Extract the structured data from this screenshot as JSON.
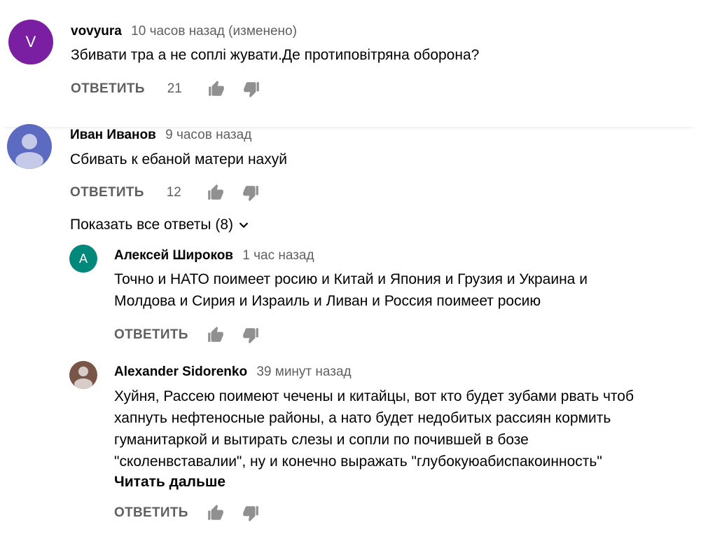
{
  "comments": [
    {
      "author": "vovyura",
      "time": "10 часов назад (изменено)",
      "avatar_letter": "V",
      "avatar_color": "#7b1fa2",
      "text": "Збивати тра а не соплі жувати.Де протиповітряна оборона?",
      "reply_label": "ОТВЕТИТЬ",
      "likes": "21"
    },
    {
      "author": "Иван Иванов",
      "time": "9 часов назад",
      "avatar_color": "#5c6bc0",
      "text": "Сбивать к ебаной матери нахуй",
      "reply_label": "ОТВЕТИТЬ",
      "likes": "12",
      "show_replies": "Показать все ответы (8)"
    }
  ],
  "replies": [
    {
      "author": "Алексей Широков",
      "time": "1 час назад",
      "avatar_letter": "А",
      "avatar_color": "#00897b",
      "text_lines": [
        "Точно и НАТО поимеет росию и Китай и Япония и Грузия и Украина и",
        "Молдова и Сирия и Израиль и Ливан и Россия поимеет росию"
      ],
      "reply_label": "ОТВЕТИТЬ"
    },
    {
      "author": "Alexander Sidorenko",
      "time": "39 минут назад",
      "avatar_color": "#795548",
      "text_lines": [
        "Хуйня, Рассею поимеют чечены и китайцы, вот кто будет зубами рвать чтоб",
        "хапнуть нефтеносные районы, а нато будет недобитых рассиян кормить",
        "гуманитаркой и вытирать слезы и сопли по почившей в бозе",
        "\"сколенвставалии\", ну и конечно выражать \"глубокуюабиспакоинность\""
      ],
      "read_more": "Читать дальше",
      "reply_label": "ОТВЕТИТЬ"
    }
  ],
  "icons": {
    "like": "thumbs-up-icon",
    "dislike": "thumbs-down-icon",
    "chevron": "chevron-down-icon",
    "person": "person-avatar-icon"
  }
}
